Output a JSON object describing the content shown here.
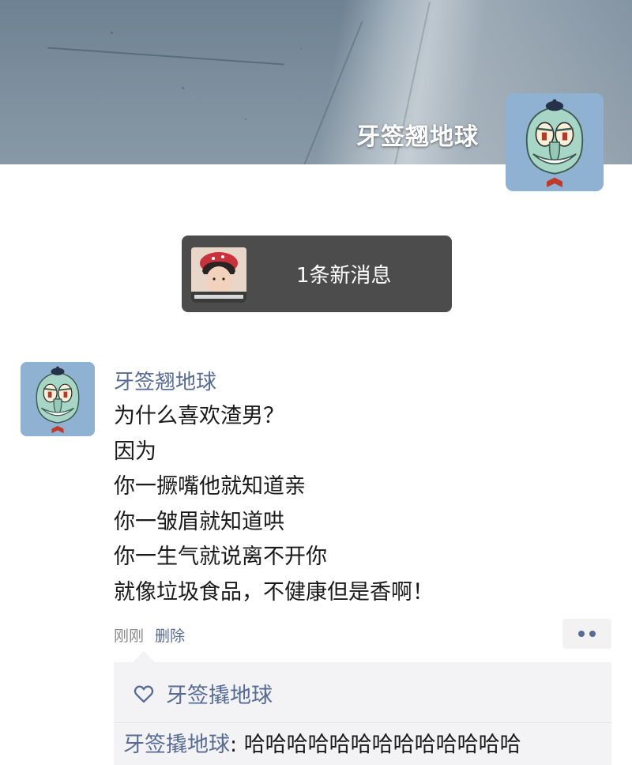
{
  "profile": {
    "cover_name": "牙签翘地球",
    "avatar_icon": "squidward-avatar-icon"
  },
  "notice": {
    "text": "1条新消息",
    "thumb_icon": "sender-avatar-icon"
  },
  "post": {
    "author": "牙签翘地球",
    "lines": [
      "为什么喜欢渣男？",
      "因为",
      "你一撅嘴他就知道亲",
      "你一皱眉就知道哄",
      "你一生气就说离不开你",
      "就像垃圾食品，不健康但是香啊！"
    ],
    "time": "刚刚",
    "delete_label": "删除",
    "more_icon": "more-dots-icon"
  },
  "likes": {
    "icon": "heart-icon",
    "names": "牙签撬地球"
  },
  "comments": [
    {
      "name": "牙签撬地球",
      "separator": ": ",
      "text": "哈哈哈哈哈哈哈哈哈哈哈哈哈"
    }
  ],
  "colors": {
    "link": "#576b95",
    "notice_bg": "#4c4c4c",
    "interact_bg": "#f3f3f5",
    "avatar_bg": "#8fb2d2"
  }
}
